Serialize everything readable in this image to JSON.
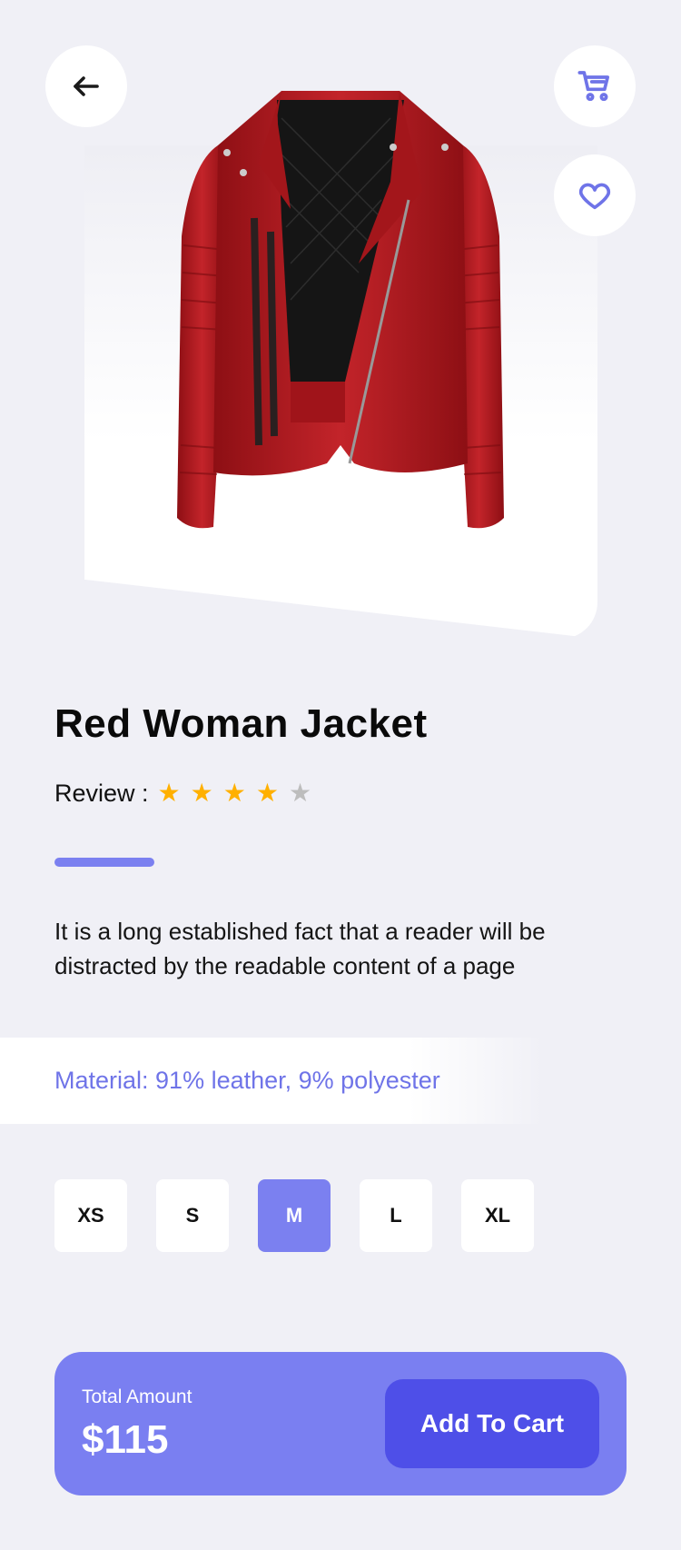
{
  "product": {
    "title": "Red Woman Jacket",
    "review_label": "Review :",
    "rating": 4,
    "rating_max": 5,
    "description": "It is a long established fact that a reader will be distracted by the readable content of a page",
    "material": "Material: 91% leather, 9% polyester"
  },
  "sizes": [
    {
      "label": "XS",
      "selected": false
    },
    {
      "label": "S",
      "selected": false
    },
    {
      "label": "M",
      "selected": true
    },
    {
      "label": "L",
      "selected": false
    },
    {
      "label": "XL",
      "selected": false
    }
  ],
  "footer": {
    "total_label": "Total Amount",
    "total_value": "$115",
    "add_button": "Add To Cart"
  },
  "icons": {
    "back": "arrow-left-icon",
    "cart": "cart-icon",
    "favorite": "heart-icon"
  },
  "colors": {
    "accent": "#7b80f0",
    "button": "#4e4fe8",
    "star": "#ffb000",
    "jacket": "#b3171c"
  }
}
